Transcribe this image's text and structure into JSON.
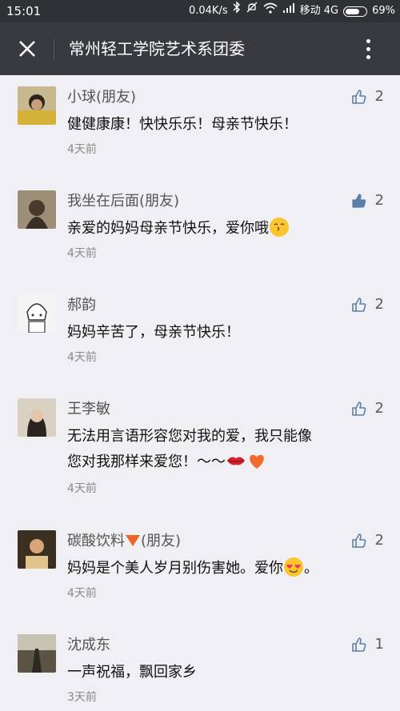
{
  "status_bar": {
    "time": "15:01",
    "network_speed": "0.04K/s",
    "carrier": "移动 4G",
    "battery": "69%",
    "battery_level": 0.69
  },
  "header": {
    "title": "常州轻工学院艺术系团委",
    "close_icon": "close-icon",
    "more_icon": "more-vertical-icon"
  },
  "comments": [
    {
      "nickname": "小球(朋友)",
      "content": "健健康康！快快乐乐！母亲节快乐！",
      "time": "4天前",
      "likes": "2",
      "liked": false
    },
    {
      "nickname": "我坐在后面(朋友)",
      "content": "亲爱的妈妈母亲节快乐，爱你哦",
      "time": "4天前",
      "likes": "2",
      "liked": true
    },
    {
      "nickname": "郝韵",
      "content": "妈妈辛苦了，母亲节快乐！",
      "time": "4天前",
      "likes": "2",
      "liked": false
    },
    {
      "nickname": "王李敏",
      "content_line1": "无法用言语形容您对我的爱，我只能像",
      "content_line2": "您对我那样来爱您！～～",
      "time": "4天前",
      "likes": "2",
      "liked": false
    },
    {
      "nickname_prefix": "碳酸饮料",
      "nickname_suffix": "(朋友)",
      "content": "妈妈是个美人岁月别伤害她。爱你",
      "content_tail": "。",
      "time": "4天前",
      "likes": "2",
      "liked": false
    },
    {
      "nickname": "沈成东",
      "content": "一声祝福，飘回家乡",
      "time": "3天前",
      "likes": "1",
      "liked": false
    }
  ],
  "colors": {
    "status_bar_bg": "#2f3134",
    "title_bar_bg": "#393a3f",
    "page_bg": "#efeff4",
    "like_outline": "#5b7fa8",
    "like_filled": "#5b7fa8"
  }
}
